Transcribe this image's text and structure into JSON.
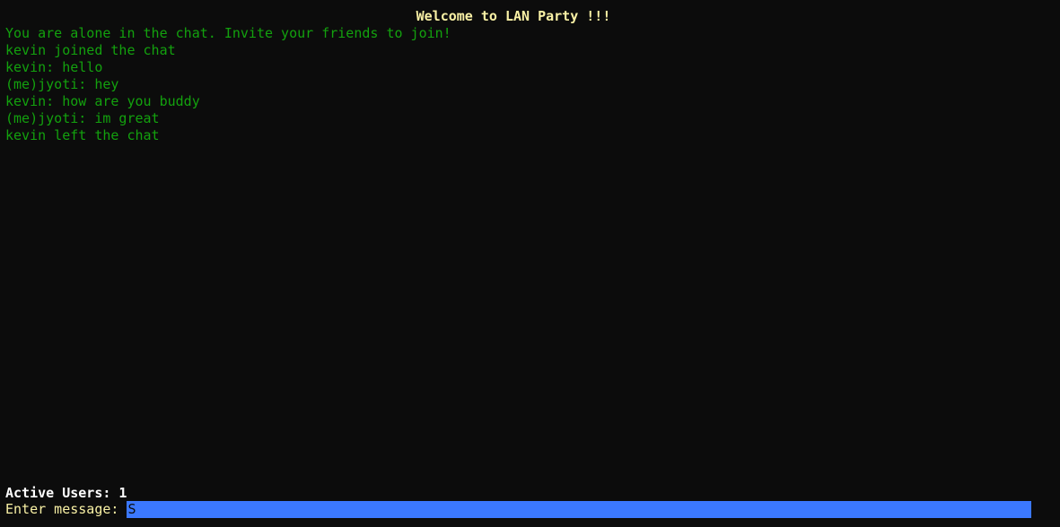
{
  "header": {
    "title": "Welcome to LAN Party !!!"
  },
  "messages": [
    "You are alone in the chat. Invite your friends to join!",
    "kevin joined the chat",
    "kevin: hello",
    "(me)jyoti: hey",
    "kevin: how are you buddy",
    "(me)jyoti: im great",
    "kevin left the chat"
  ],
  "status": {
    "active_users": "Active Users: 1"
  },
  "input": {
    "label": "Enter message: ",
    "value": "S"
  },
  "colors": {
    "background": "#0c0c0c",
    "title": "#f9f1a5",
    "message": "#13a10e",
    "input_highlight": "#3b78ff"
  }
}
